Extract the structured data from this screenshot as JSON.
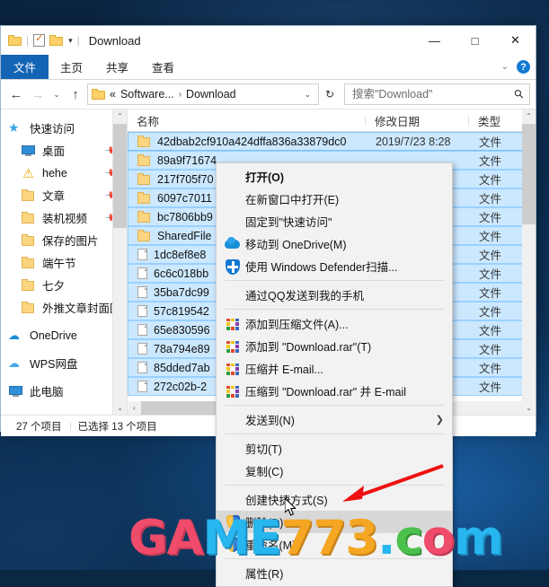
{
  "window": {
    "title": "Download",
    "quick_access_icons": [
      "folder-icon",
      "properties-icon",
      "folder-new-icon",
      "caret-down-icon"
    ],
    "controls": {
      "minimize": "—",
      "maximize": "□",
      "close": "✕"
    },
    "ribbon_expand": "⌄",
    "help": "?"
  },
  "ribbon": {
    "tabs": [
      {
        "label": "文件",
        "active": true
      },
      {
        "label": "主页",
        "active": false
      },
      {
        "label": "共享",
        "active": false
      },
      {
        "label": "查看",
        "active": false
      }
    ]
  },
  "address": {
    "back": "←",
    "forward": "→",
    "recent": "⌄",
    "up": "↑",
    "folder_icon": "folder-icon",
    "crumbs": [
      "«",
      "Software...",
      "Download"
    ],
    "sep": "›",
    "dropdown": "⌄",
    "refresh": "↻"
  },
  "search": {
    "placeholder": "搜索\"Download\"",
    "value": "",
    "icon": "search-icon"
  },
  "sidebar": {
    "items": [
      {
        "label": "快速访问",
        "icon": "star-pin-icon",
        "level": 0,
        "pinned": false
      },
      {
        "label": "桌面",
        "icon": "desktop-icon",
        "level": 1,
        "pinned": true
      },
      {
        "label": "hehe",
        "icon": "warning-icon",
        "level": 1,
        "pinned": true
      },
      {
        "label": "文章",
        "icon": "folder-icon",
        "level": 1,
        "pinned": true
      },
      {
        "label": "装机视频",
        "icon": "folder-icon",
        "level": 1,
        "pinned": true
      },
      {
        "label": "保存的图片",
        "icon": "folder-icon",
        "level": 1,
        "pinned": false
      },
      {
        "label": "端午节",
        "icon": "folder-icon",
        "level": 1,
        "pinned": false
      },
      {
        "label": "七夕",
        "icon": "folder-icon",
        "level": 1,
        "pinned": false
      },
      {
        "label": "外推文章封面图",
        "icon": "folder-icon",
        "level": 1,
        "pinned": false
      },
      {
        "label": "OneDrive",
        "icon": "onedrive-icon",
        "level": 0,
        "pinned": false
      },
      {
        "label": "WPS网盘",
        "icon": "wps-cloud-icon",
        "level": 0,
        "pinned": false
      },
      {
        "label": "此电脑",
        "icon": "this-pc-icon",
        "level": 0,
        "pinned": false
      }
    ],
    "scroll_up": "⌃",
    "scroll_down": "⌄"
  },
  "filelist": {
    "columns": [
      {
        "key": "name",
        "label": "名称"
      },
      {
        "key": "date",
        "label": "修改日期"
      },
      {
        "key": "type",
        "label": "类型"
      }
    ],
    "sort_indicator": "⌃",
    "rows": [
      {
        "name": "42dbab2cf910a424dffa836a33879dc0",
        "date": "2019/7/23 8:28",
        "type": "文件",
        "icon": "folder-icon",
        "selected": true
      },
      {
        "name": "89a9f71674",
        "date": "",
        "type": "文件",
        "icon": "folder-icon",
        "selected": true
      },
      {
        "name": "217f705f70",
        "date": "",
        "type": "文件",
        "icon": "folder-icon",
        "selected": true
      },
      {
        "name": "6097c7011",
        "date": "",
        "type": "文件",
        "icon": "folder-icon",
        "selected": true
      },
      {
        "name": "bc7806bb9",
        "date": "",
        "type": "文件",
        "icon": "folder-icon",
        "selected": true
      },
      {
        "name": "SharedFile",
        "date": "",
        "type": "文件",
        "icon": "folder-icon",
        "selected": true
      },
      {
        "name": "1dc8ef8e8",
        "date": "",
        "type": "文件",
        "icon": "file-icon",
        "selected": true
      },
      {
        "name": "6c6c018bb",
        "date": "",
        "type": "文件",
        "icon": "file-icon",
        "selected": true
      },
      {
        "name": "35ba7dc99",
        "date": "",
        "type": "文件",
        "icon": "file-icon",
        "selected": true
      },
      {
        "name": "57c819542",
        "date": "",
        "type": "文件",
        "icon": "file-icon",
        "selected": true
      },
      {
        "name": "65e830596",
        "date": "",
        "type": "文件",
        "icon": "file-icon",
        "selected": true
      },
      {
        "name": "78a794e89",
        "date": "",
        "type": "文件",
        "icon": "file-icon",
        "selected": true
      },
      {
        "name": "85dded7ab",
        "date": "",
        "type": "文件",
        "icon": "file-icon",
        "selected": true
      },
      {
        "name": "272c02b-2",
        "date": "",
        "type": "文件",
        "icon": "file-icon",
        "selected": true
      }
    ],
    "hscroll_left": "‹",
    "hscroll_right": "›"
  },
  "statusbar": {
    "count": "27 个项目",
    "selected": "已选择 13 个项目"
  },
  "context_menu": {
    "items": [
      {
        "label": "打开(O)",
        "icon": null,
        "bold": true,
        "highlighted": false,
        "submenu": false
      },
      {
        "label": "在新窗口中打开(E)",
        "icon": null,
        "bold": false,
        "highlighted": false,
        "submenu": false
      },
      {
        "label": "固定到\"快速访问\"",
        "icon": null,
        "bold": false,
        "highlighted": false,
        "submenu": false
      },
      {
        "label": "移动到 OneDrive(M)",
        "icon": "onedrive-icon",
        "bold": false,
        "highlighted": false,
        "submenu": false
      },
      {
        "label": "使用 Windows Defender扫描...",
        "icon": "defender-icon",
        "bold": false,
        "highlighted": false,
        "submenu": false
      },
      {
        "separator": true
      },
      {
        "label": "通过QQ发送到我的手机",
        "icon": null,
        "bold": false,
        "highlighted": false,
        "submenu": false
      },
      {
        "separator": true
      },
      {
        "label": "添加到压缩文件(A)...",
        "icon": "winrar-icon",
        "bold": false,
        "highlighted": false,
        "submenu": false
      },
      {
        "label": "添加到 \"Download.rar\"(T)",
        "icon": "winrar-icon",
        "bold": false,
        "highlighted": false,
        "submenu": false
      },
      {
        "label": "压缩并 E-mail...",
        "icon": "winrar-icon",
        "bold": false,
        "highlighted": false,
        "submenu": false
      },
      {
        "label": "压缩到 \"Download.rar\" 并 E-mail",
        "icon": "winrar-icon",
        "bold": false,
        "highlighted": false,
        "submenu": false
      },
      {
        "separator": true
      },
      {
        "label": "发送到(N)",
        "icon": null,
        "bold": false,
        "highlighted": false,
        "submenu": true,
        "arrow": "❯"
      },
      {
        "separator": true
      },
      {
        "label": "剪切(T)",
        "icon": null,
        "bold": false,
        "highlighted": false,
        "submenu": false
      },
      {
        "label": "复制(C)",
        "icon": null,
        "bold": false,
        "highlighted": false,
        "submenu": false
      },
      {
        "separator": true
      },
      {
        "label": "创建快捷方式(S)",
        "icon": null,
        "bold": false,
        "highlighted": false,
        "submenu": false
      },
      {
        "label": "删除(D)",
        "icon": "shield-icon",
        "bold": false,
        "highlighted": true,
        "submenu": false
      },
      {
        "label": "重命名(M)",
        "icon": "shield-icon",
        "bold": false,
        "highlighted": false,
        "submenu": false
      },
      {
        "separator": true
      },
      {
        "label": "属性(R)",
        "icon": null,
        "bold": false,
        "highlighted": false,
        "submenu": false
      }
    ]
  },
  "annotation": {
    "arrow_color": "#ee1111",
    "points_to": "删除(D)"
  },
  "watermark": {
    "parts": [
      {
        "text": "G",
        "color": "#ef4b6a"
      },
      {
        "text": "A",
        "color": "#ef4b6a"
      },
      {
        "text": "M",
        "color": "#27b6ef"
      },
      {
        "text": "E",
        "color": "#27b6ef"
      },
      {
        "text": "7",
        "color": "#f5a623"
      },
      {
        "text": "7",
        "color": "#f5a623"
      },
      {
        "text": "3",
        "color": "#f5a623"
      },
      {
        "text": ".",
        "color": "#27b6ef"
      },
      {
        "text": "c",
        "color": "#4cc04c"
      },
      {
        "text": "o",
        "color": "#ef4b6a"
      },
      {
        "text": "m",
        "color": "#27b6ef"
      }
    ]
  },
  "colors": {
    "accent": "#1364b5",
    "selection": "#cce8ff",
    "menu_bg": "#f2f2f2",
    "menu_highlight": "#d8d8d8"
  }
}
